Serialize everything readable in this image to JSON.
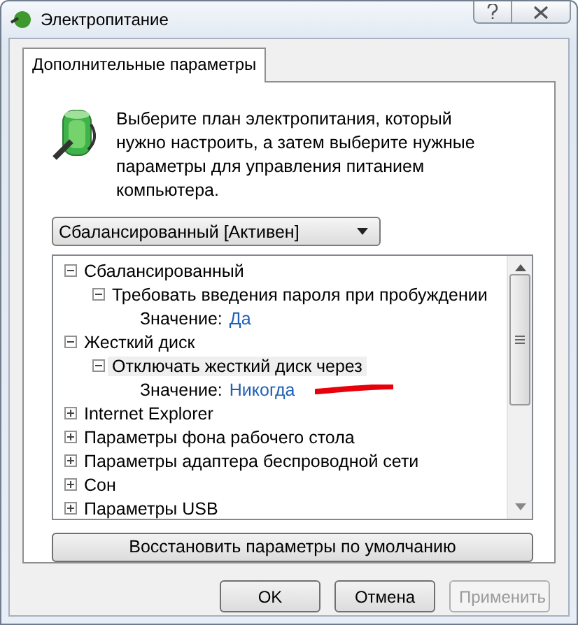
{
  "window": {
    "title": "Электропитание"
  },
  "tabs": [
    {
      "label": "Дополнительные параметры",
      "selected": true
    }
  ],
  "intro": "Выберите план электропитания, который нужно настроить, а затем выберите нужные параметры для управления питанием компьютера.",
  "plan_dropdown": {
    "value": "Сбалансированный [Активен]"
  },
  "tree": [
    {
      "kind": "group",
      "label": "Сбалансированный",
      "expanded": true,
      "selected": false,
      "children": [
        {
          "kind": "group",
          "label": "Требовать введения пароля при пробуждении",
          "expanded": true,
          "selected": false,
          "children": [
            {
              "kind": "value",
              "label": "Значение:",
              "value": "Да"
            }
          ]
        }
      ]
    },
    {
      "kind": "group",
      "label": "Жесткий диск",
      "expanded": true,
      "selected": false,
      "children": [
        {
          "kind": "group",
          "label": "Отключать жесткий диск через",
          "expanded": true,
          "selected": true,
          "children": [
            {
              "kind": "value",
              "label": "Значение:",
              "value": "Никогда",
              "marked": true
            }
          ]
        }
      ]
    },
    {
      "kind": "group",
      "label": "Internet Explorer",
      "expanded": false,
      "selected": false
    },
    {
      "kind": "group",
      "label": "Параметры фона рабочего стола",
      "expanded": false,
      "selected": false
    },
    {
      "kind": "group",
      "label": "Параметры адаптера беспроводной сети",
      "expanded": false,
      "selected": false
    },
    {
      "kind": "group",
      "label": "Сон",
      "expanded": false,
      "selected": false
    },
    {
      "kind": "group",
      "label": "Параметры USB",
      "expanded": false,
      "selected": false
    }
  ],
  "restore_button": "Восстановить параметры по умолчанию",
  "buttons": [
    {
      "label": "OK",
      "disabled": false
    },
    {
      "label": "Отмена",
      "disabled": false
    },
    {
      "label": "Применить",
      "disabled": true
    }
  ]
}
